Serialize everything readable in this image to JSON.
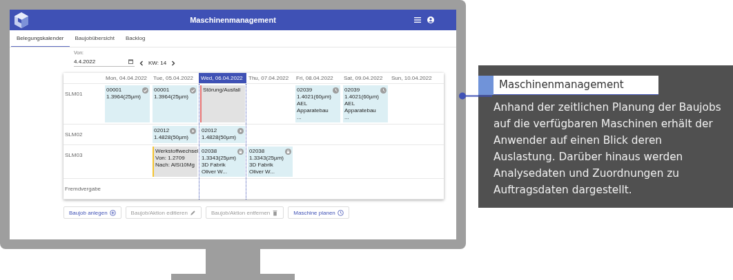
{
  "app": {
    "title": "Maschinenmanagement"
  },
  "tabs": [
    {
      "label": "Belegungskalender",
      "selected": true
    },
    {
      "label": "Baujobübersicht",
      "selected": false
    },
    {
      "label": "Backlog",
      "selected": false
    }
  ],
  "date_filter": {
    "label": "Von:",
    "value": "4.4.2022",
    "week": "KW: 14"
  },
  "calendar": {
    "days": [
      {
        "label": "Mon, 04.04.2022",
        "selected": false
      },
      {
        "label": "Tue, 05.04.2022",
        "selected": false
      },
      {
        "label": "Wed, 06.04.2022",
        "selected": true
      },
      {
        "label": "Thu, 07.04.2022",
        "selected": false
      },
      {
        "label": "Fri, 08.04.2022",
        "selected": false
      },
      {
        "label": "Sat, 09.04.2022",
        "selected": false
      },
      {
        "label": "Sun, 10.04.2022",
        "selected": false
      }
    ],
    "rows": [
      {
        "machine": "SLM01",
        "cells": [
          {
            "kind": "completed",
            "lines": [
              "00001",
              "1.3964(25µm)"
            ]
          },
          {
            "kind": "completed",
            "lines": [
              "00001",
              "1.3964(25µm)"
            ]
          },
          {
            "kind": "disruption",
            "lines": [
              "Störung/Ausfall"
            ]
          },
          null,
          {
            "kind": "scheduled",
            "lines": [
              "02039",
              "1.4021(60µm)",
              "AEL Apparatebau ..."
            ]
          },
          {
            "kind": "scheduled",
            "lines": [
              "02039",
              "1.4021(60µm)",
              "AEL Apparatebau ..."
            ]
          },
          null
        ]
      },
      {
        "machine": "SLM02",
        "cells": [
          null,
          {
            "kind": "running",
            "lines": [
              "02012",
              "1.4828(50µm)"
            ]
          },
          {
            "kind": "running",
            "lines": [
              "02012",
              "1.4828(50µm)"
            ]
          },
          null,
          null,
          null,
          null
        ]
      },
      {
        "machine": "SLM03",
        "cells": [
          null,
          {
            "kind": "changeover",
            "lines": [
              "Werkstoffwechsel",
              "Von: 1.2709",
              "Nach: AlSi10Mg"
            ]
          },
          {
            "kind": "locked",
            "lines": [
              "02038",
              "1.3343(25µm)",
              "3D Fabrik Oliver W..."
            ]
          },
          {
            "kind": "locked",
            "lines": [
              "02038",
              "1.3343(25µm)",
              "3D Fabrik Oliver W..."
            ]
          },
          null,
          null,
          null
        ]
      },
      {
        "machine": "Fremdvergabe"
      }
    ]
  },
  "buttons": [
    {
      "label": "Baujob anlegen",
      "kind": "add",
      "disabled": false
    },
    {
      "label": "Baujob/Aktion editieren",
      "kind": "edit",
      "disabled": true
    },
    {
      "label": "Baujob/Aktion entfernen",
      "kind": "delete",
      "disabled": true
    },
    {
      "label": "Maschine planen",
      "kind": "schedule",
      "disabled": false
    }
  ],
  "callout": {
    "title": "Maschinenmanagement",
    "text": "Anhand der zeitlichen Planung der Baujobs auf die verfügbaren Maschinen erhält der Anwender auf einen Blick deren Auslastung. Darüber hinaus werden Analysedaten und Zuordnungen zu Auftragsdaten dargestellt."
  }
}
